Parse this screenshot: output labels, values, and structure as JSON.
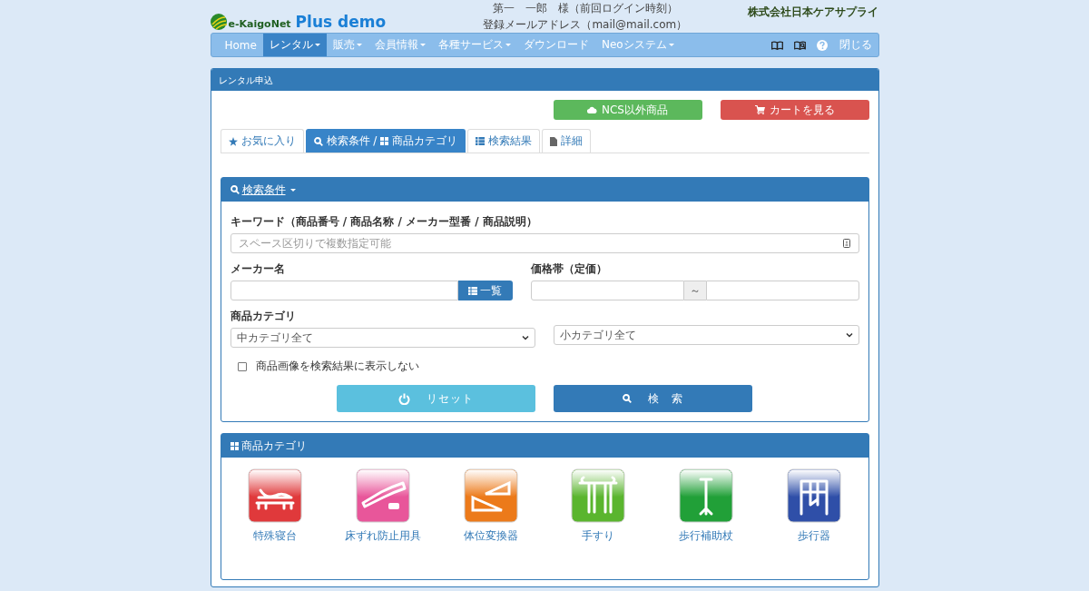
{
  "header": {
    "logo_prefix": "e-KaigoNet",
    "logo_suffix": "Plus demo",
    "user_line": "第一　一郎　様（前回ログイン時刻）",
    "email_line": "登録メールアドレス（mail@mail.com）",
    "company": "株式会社日本ケアサプライ"
  },
  "navbar": {
    "items": [
      {
        "label": "Home",
        "dropdown": false,
        "selected": false
      },
      {
        "label": "レンタル",
        "dropdown": true,
        "selected": true
      },
      {
        "label": "販売",
        "dropdown": true,
        "selected": false
      },
      {
        "label": "会員情報",
        "dropdown": true,
        "selected": false
      },
      {
        "label": "各種サービス",
        "dropdown": true,
        "selected": false
      },
      {
        "label": "ダウンロード",
        "dropdown": false,
        "selected": false
      },
      {
        "label": "Neoシステム",
        "dropdown": true,
        "selected": false
      }
    ],
    "right_items": [
      {
        "kind": "book"
      },
      {
        "kind": "book-search"
      },
      {
        "kind": "help"
      },
      {
        "kind": "text",
        "label": "閉じる"
      }
    ]
  },
  "panel": {
    "title": "レンタル申込",
    "buttons": [
      {
        "kind": "success",
        "label": "NCS以外商品"
      },
      {
        "kind": "danger",
        "label": "カートを見る"
      }
    ],
    "tabs": [
      {
        "selected": false,
        "parts": [
          {
            "kind": "star",
            "text": "お気に入り"
          }
        ]
      },
      {
        "selected": true,
        "parts": [
          {
            "kind": "search",
            "text": "検索条件 /"
          },
          {
            "kind": "grid",
            "text": "商品カテゴリ"
          }
        ]
      },
      {
        "selected": false,
        "parts": [
          {
            "kind": "list",
            "text": "検索結果"
          }
        ]
      },
      {
        "selected": false,
        "parts": [
          {
            "kind": "file",
            "text": "詳細"
          }
        ]
      }
    ]
  },
  "search_panel": {
    "title": "検索条件",
    "keyword": {
      "label": "キーワード（商品番号 / 商品名称 / メーカー型番 / 商品説明）",
      "placeholder": "スペース区切りで複数指定可能"
    },
    "maker": {
      "label": "メーカー名",
      "button": "一覧"
    },
    "price": {
      "label": "価格帯（定価）",
      "separator": "～"
    },
    "category": {
      "label": "商品カテゴリ",
      "middle": "中カテゴリ全て",
      "small": "小カテゴリ全て"
    },
    "hide_images": {
      "label": "商品画像を検索結果に表示しない",
      "checked": false
    },
    "reset_button": "リセット",
    "search_button": "検　索"
  },
  "category_panel": {
    "title": "商品カテゴリ",
    "items": [
      {
        "kind": "bed",
        "color": "#e0393b",
        "label": "特殊寝台"
      },
      {
        "kind": "mattress",
        "color": "#e8569a",
        "label": "床ずれ防止用具"
      },
      {
        "kind": "cushion",
        "color": "#ec7a1a",
        "label": "体位変換器"
      },
      {
        "kind": "handrail",
        "color": "#5ab52e",
        "label": "手すり"
      },
      {
        "kind": "cane",
        "color": "#21a038",
        "label": "歩行補助杖"
      },
      {
        "kind": "walker",
        "color": "#2f4fa8",
        "label": "歩行器"
      }
    ]
  }
}
